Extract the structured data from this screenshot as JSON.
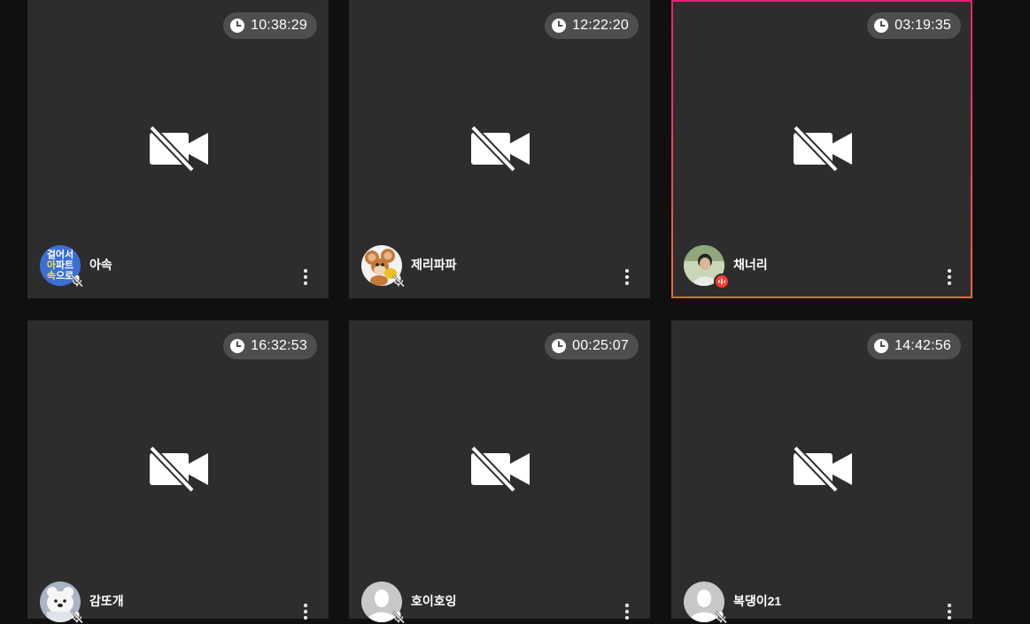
{
  "colors": {
    "background": "#101010",
    "tile": "#2d2d2d",
    "timer_pill": "#4e4e4e",
    "active_border_top": "#e8207a",
    "active_border_bottom": "#f0663a",
    "live_badge": "#ff3b30"
  },
  "tiles": [
    {
      "name": "아속",
      "timer": "10:38:29",
      "camera": "off",
      "mic": "off",
      "active": false,
      "avatar": "text-logo-avatar"
    },
    {
      "name": "제리파파",
      "timer": "12:22:20",
      "camera": "off",
      "mic": "off",
      "active": false,
      "avatar": "cartoon-mouse-avatar"
    },
    {
      "name": "채너리",
      "timer": "03:19:35",
      "camera": "off",
      "mic": "live",
      "active": true,
      "avatar": "photo-avatar"
    },
    {
      "name": "감또개",
      "timer": "16:32:53",
      "camera": "off",
      "mic": "off",
      "active": false,
      "avatar": "bear-avatar"
    },
    {
      "name": "호이호잉",
      "timer": "00:25:07",
      "camera": "off",
      "mic": "off",
      "active": false,
      "avatar": "default-person-avatar"
    },
    {
      "name": "복댕이21",
      "timer": "14:42:56",
      "camera": "off",
      "mic": "off",
      "active": false,
      "avatar": "default-person-avatar"
    }
  ],
  "avatar_text": {
    "line1": "걸어서",
    "line2a": "아",
    "line2b": "파트",
    "line3a": "속",
    "line3b": "으로"
  }
}
